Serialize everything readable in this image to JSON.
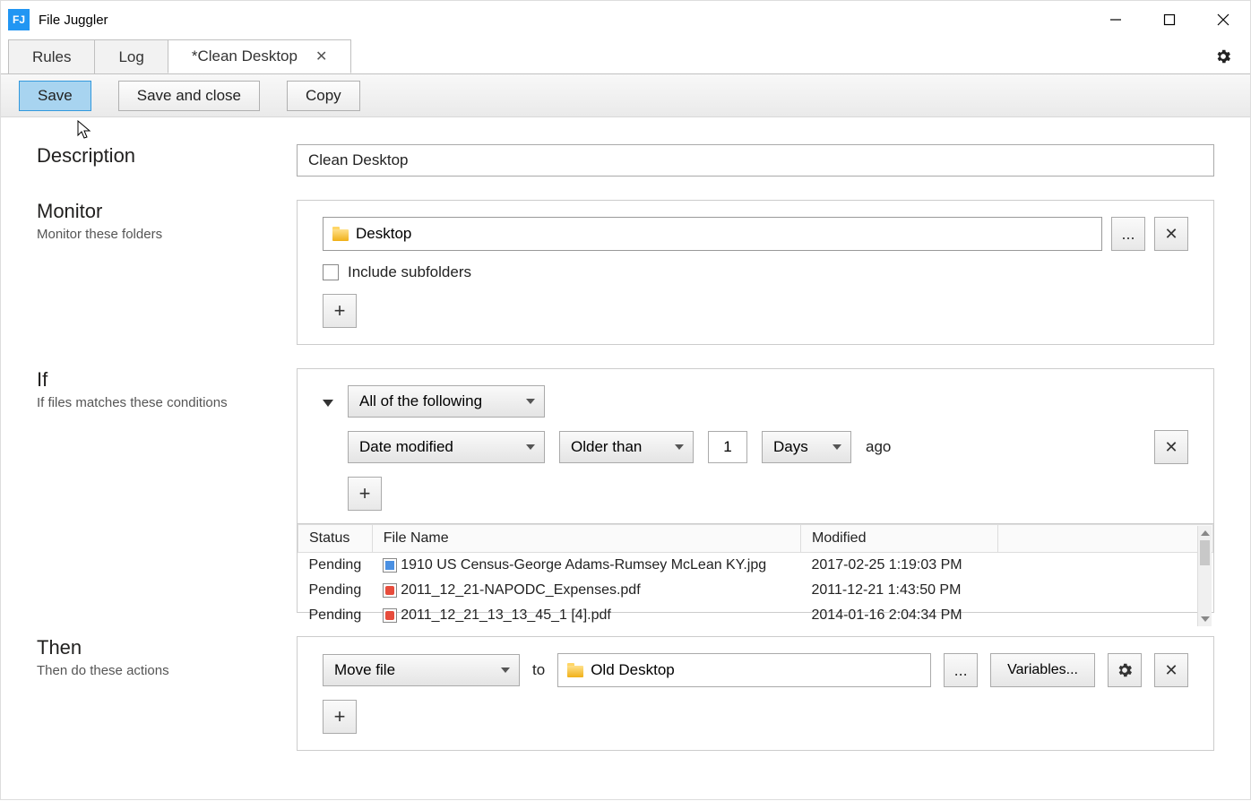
{
  "app": {
    "title": "File Juggler",
    "icon_letter": "FJ"
  },
  "tabs": {
    "rules": "Rules",
    "log": "Log",
    "active": "*Clean Desktop"
  },
  "toolbar": {
    "save": "Save",
    "save_close": "Save and close",
    "copy": "Copy"
  },
  "sections": {
    "description": {
      "title": "Description",
      "value": "Clean Desktop"
    },
    "monitor": {
      "title": "Monitor",
      "subtitle": "Monitor these folders",
      "folder": "Desktop",
      "browse": "...",
      "include_subfolders": "Include subfolders"
    },
    "if": {
      "title": "If",
      "subtitle": "If files matches these conditions",
      "group_mode": "All of the following",
      "cond_field": "Date modified",
      "cond_op": "Older than",
      "cond_value": "1",
      "cond_unit": "Days",
      "cond_suffix": "ago"
    },
    "files": {
      "headers": {
        "status": "Status",
        "name": "File Name",
        "modified": "Modified"
      },
      "rows": [
        {
          "status": "Pending",
          "icon": "img",
          "name": "1910 US Census-George  Adams-Rumsey McLean KY.jpg",
          "modified": "2017-02-25 1:19:03 PM"
        },
        {
          "status": "Pending",
          "icon": "pdf",
          "name": "2011_12_21-NAPODC_Expenses.pdf",
          "modified": "2011-12-21 1:43:50 PM"
        },
        {
          "status": "Pending",
          "icon": "pdf",
          "name": "2011_12_21_13_13_45_1 [4].pdf",
          "modified": "2014-01-16 2:04:34 PM"
        }
      ]
    },
    "then": {
      "title": "Then",
      "subtitle": "Then do these actions",
      "action": "Move file",
      "to_label": "to",
      "destination": "Old Desktop",
      "browse": "...",
      "variables": "Variables..."
    }
  }
}
